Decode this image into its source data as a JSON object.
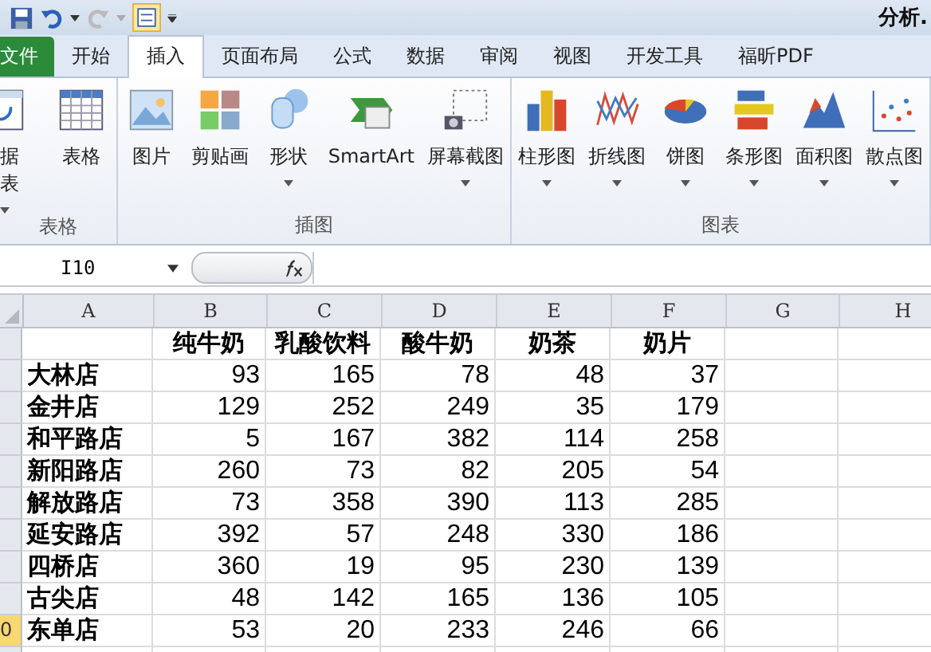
{
  "title_bar": {
    "title": "分析."
  },
  "tabs": [
    {
      "label": "文件",
      "kind": "file",
      "selected": false
    },
    {
      "label": "开始",
      "kind": "tab",
      "selected": false
    },
    {
      "label": "插入",
      "kind": "tab",
      "selected": true
    },
    {
      "label": "页面布局",
      "kind": "tab",
      "selected": false
    },
    {
      "label": "公式",
      "kind": "tab",
      "selected": false
    },
    {
      "label": "数据",
      "kind": "tab",
      "selected": false
    },
    {
      "label": "审阅",
      "kind": "tab",
      "selected": false
    },
    {
      "label": "视图",
      "kind": "tab",
      "selected": false
    },
    {
      "label": "开发工具",
      "kind": "tab",
      "selected": false
    },
    {
      "label": "福昕PDF",
      "kind": "tab",
      "selected": false
    }
  ],
  "ribbon_groups": [
    {
      "label": "表格",
      "buttons": [
        {
          "lines": [
            "据",
            "表"
          ],
          "dropdown": true
        },
        {
          "lines": [
            "表格"
          ],
          "dropdown": false
        }
      ]
    },
    {
      "label": "插图",
      "buttons": [
        {
          "lines": [
            "图片"
          ],
          "dropdown": false
        },
        {
          "lines": [
            "剪贴画"
          ],
          "dropdown": false
        },
        {
          "lines": [
            "形状"
          ],
          "dropdown": true
        },
        {
          "lines": [
            "SmartArt"
          ],
          "dropdown": false
        },
        {
          "lines": [
            "屏幕截图"
          ],
          "dropdown": true
        }
      ]
    },
    {
      "label": "图表",
      "buttons": [
        {
          "lines": [
            "柱形图"
          ],
          "dropdown": true
        },
        {
          "lines": [
            "折线图"
          ],
          "dropdown": true
        },
        {
          "lines": [
            "饼图"
          ],
          "dropdown": true
        },
        {
          "lines": [
            "条形图"
          ],
          "dropdown": true
        },
        {
          "lines": [
            "面积图"
          ],
          "dropdown": true
        },
        {
          "lines": [
            "散点图"
          ],
          "dropdown": true
        }
      ]
    }
  ],
  "formula_bar": {
    "name_box": "I10"
  },
  "columns": [
    "A",
    "B",
    "C",
    "D",
    "E",
    "F",
    "G",
    "H"
  ],
  "rows": [
    {
      "selected": false,
      "cells": [
        null,
        "纯牛奶",
        "乳酸饮料",
        "酸牛奶",
        "奶茶",
        "奶片"
      ]
    },
    {
      "selected": false,
      "cells": [
        "大林店",
        "93",
        "165",
        "78",
        "48",
        "37"
      ]
    },
    {
      "selected": false,
      "cells": [
        "金井店",
        "129",
        "252",
        "249",
        "35",
        "179"
      ]
    },
    {
      "selected": false,
      "cells": [
        "和平路店",
        "5",
        "167",
        "382",
        "114",
        "258"
      ]
    },
    {
      "selected": false,
      "cells": [
        "新阳路店",
        "260",
        "73",
        "82",
        "205",
        "54"
      ]
    },
    {
      "selected": false,
      "cells": [
        "解放路店",
        "73",
        "358",
        "390",
        "113",
        "285"
      ]
    },
    {
      "selected": false,
      "cells": [
        "延安路店",
        "392",
        "57",
        "248",
        "330",
        "186"
      ]
    },
    {
      "selected": false,
      "cells": [
        "四桥店",
        "360",
        "19",
        "95",
        "230",
        "139"
      ]
    },
    {
      "selected": false,
      "cells": [
        "古尖店",
        "48",
        "142",
        "165",
        "136",
        "105"
      ]
    },
    {
      "selected": true,
      "label": "0",
      "cells": [
        "东单店",
        "53",
        "20",
        "233",
        "246",
        "66"
      ]
    },
    {
      "selected": false,
      "cells": []
    }
  ]
}
